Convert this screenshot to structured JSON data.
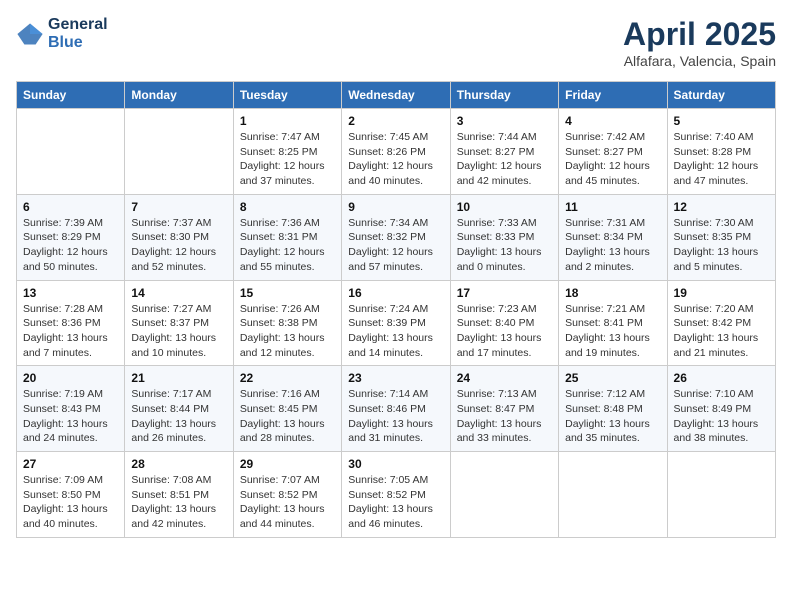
{
  "header": {
    "logo_line1": "General",
    "logo_line2": "Blue",
    "title": "April 2025",
    "subtitle": "Alfafara, Valencia, Spain"
  },
  "days_of_week": [
    "Sunday",
    "Monday",
    "Tuesday",
    "Wednesday",
    "Thursday",
    "Friday",
    "Saturday"
  ],
  "weeks": [
    [
      {
        "day": "",
        "sunrise": "",
        "sunset": "",
        "daylight": ""
      },
      {
        "day": "",
        "sunrise": "",
        "sunset": "",
        "daylight": ""
      },
      {
        "day": "1",
        "sunrise": "Sunrise: 7:47 AM",
        "sunset": "Sunset: 8:25 PM",
        "daylight": "Daylight: 12 hours and 37 minutes."
      },
      {
        "day": "2",
        "sunrise": "Sunrise: 7:45 AM",
        "sunset": "Sunset: 8:26 PM",
        "daylight": "Daylight: 12 hours and 40 minutes."
      },
      {
        "day": "3",
        "sunrise": "Sunrise: 7:44 AM",
        "sunset": "Sunset: 8:27 PM",
        "daylight": "Daylight: 12 hours and 42 minutes."
      },
      {
        "day": "4",
        "sunrise": "Sunrise: 7:42 AM",
        "sunset": "Sunset: 8:27 PM",
        "daylight": "Daylight: 12 hours and 45 minutes."
      },
      {
        "day": "5",
        "sunrise": "Sunrise: 7:40 AM",
        "sunset": "Sunset: 8:28 PM",
        "daylight": "Daylight: 12 hours and 47 minutes."
      }
    ],
    [
      {
        "day": "6",
        "sunrise": "Sunrise: 7:39 AM",
        "sunset": "Sunset: 8:29 PM",
        "daylight": "Daylight: 12 hours and 50 minutes."
      },
      {
        "day": "7",
        "sunrise": "Sunrise: 7:37 AM",
        "sunset": "Sunset: 8:30 PM",
        "daylight": "Daylight: 12 hours and 52 minutes."
      },
      {
        "day": "8",
        "sunrise": "Sunrise: 7:36 AM",
        "sunset": "Sunset: 8:31 PM",
        "daylight": "Daylight: 12 hours and 55 minutes."
      },
      {
        "day": "9",
        "sunrise": "Sunrise: 7:34 AM",
        "sunset": "Sunset: 8:32 PM",
        "daylight": "Daylight: 12 hours and 57 minutes."
      },
      {
        "day": "10",
        "sunrise": "Sunrise: 7:33 AM",
        "sunset": "Sunset: 8:33 PM",
        "daylight": "Daylight: 13 hours and 0 minutes."
      },
      {
        "day": "11",
        "sunrise": "Sunrise: 7:31 AM",
        "sunset": "Sunset: 8:34 PM",
        "daylight": "Daylight: 13 hours and 2 minutes."
      },
      {
        "day": "12",
        "sunrise": "Sunrise: 7:30 AM",
        "sunset": "Sunset: 8:35 PM",
        "daylight": "Daylight: 13 hours and 5 minutes."
      }
    ],
    [
      {
        "day": "13",
        "sunrise": "Sunrise: 7:28 AM",
        "sunset": "Sunset: 8:36 PM",
        "daylight": "Daylight: 13 hours and 7 minutes."
      },
      {
        "day": "14",
        "sunrise": "Sunrise: 7:27 AM",
        "sunset": "Sunset: 8:37 PM",
        "daylight": "Daylight: 13 hours and 10 minutes."
      },
      {
        "day": "15",
        "sunrise": "Sunrise: 7:26 AM",
        "sunset": "Sunset: 8:38 PM",
        "daylight": "Daylight: 13 hours and 12 minutes."
      },
      {
        "day": "16",
        "sunrise": "Sunrise: 7:24 AM",
        "sunset": "Sunset: 8:39 PM",
        "daylight": "Daylight: 13 hours and 14 minutes."
      },
      {
        "day": "17",
        "sunrise": "Sunrise: 7:23 AM",
        "sunset": "Sunset: 8:40 PM",
        "daylight": "Daylight: 13 hours and 17 minutes."
      },
      {
        "day": "18",
        "sunrise": "Sunrise: 7:21 AM",
        "sunset": "Sunset: 8:41 PM",
        "daylight": "Daylight: 13 hours and 19 minutes."
      },
      {
        "day": "19",
        "sunrise": "Sunrise: 7:20 AM",
        "sunset": "Sunset: 8:42 PM",
        "daylight": "Daylight: 13 hours and 21 minutes."
      }
    ],
    [
      {
        "day": "20",
        "sunrise": "Sunrise: 7:19 AM",
        "sunset": "Sunset: 8:43 PM",
        "daylight": "Daylight: 13 hours and 24 minutes."
      },
      {
        "day": "21",
        "sunrise": "Sunrise: 7:17 AM",
        "sunset": "Sunset: 8:44 PM",
        "daylight": "Daylight: 13 hours and 26 minutes."
      },
      {
        "day": "22",
        "sunrise": "Sunrise: 7:16 AM",
        "sunset": "Sunset: 8:45 PM",
        "daylight": "Daylight: 13 hours and 28 minutes."
      },
      {
        "day": "23",
        "sunrise": "Sunrise: 7:14 AM",
        "sunset": "Sunset: 8:46 PM",
        "daylight": "Daylight: 13 hours and 31 minutes."
      },
      {
        "day": "24",
        "sunrise": "Sunrise: 7:13 AM",
        "sunset": "Sunset: 8:47 PM",
        "daylight": "Daylight: 13 hours and 33 minutes."
      },
      {
        "day": "25",
        "sunrise": "Sunrise: 7:12 AM",
        "sunset": "Sunset: 8:48 PM",
        "daylight": "Daylight: 13 hours and 35 minutes."
      },
      {
        "day": "26",
        "sunrise": "Sunrise: 7:10 AM",
        "sunset": "Sunset: 8:49 PM",
        "daylight": "Daylight: 13 hours and 38 minutes."
      }
    ],
    [
      {
        "day": "27",
        "sunrise": "Sunrise: 7:09 AM",
        "sunset": "Sunset: 8:50 PM",
        "daylight": "Daylight: 13 hours and 40 minutes."
      },
      {
        "day": "28",
        "sunrise": "Sunrise: 7:08 AM",
        "sunset": "Sunset: 8:51 PM",
        "daylight": "Daylight: 13 hours and 42 minutes."
      },
      {
        "day": "29",
        "sunrise": "Sunrise: 7:07 AM",
        "sunset": "Sunset: 8:52 PM",
        "daylight": "Daylight: 13 hours and 44 minutes."
      },
      {
        "day": "30",
        "sunrise": "Sunrise: 7:05 AM",
        "sunset": "Sunset: 8:52 PM",
        "daylight": "Daylight: 13 hours and 46 minutes."
      },
      {
        "day": "",
        "sunrise": "",
        "sunset": "",
        "daylight": ""
      },
      {
        "day": "",
        "sunrise": "",
        "sunset": "",
        "daylight": ""
      },
      {
        "day": "",
        "sunrise": "",
        "sunset": "",
        "daylight": ""
      }
    ]
  ]
}
